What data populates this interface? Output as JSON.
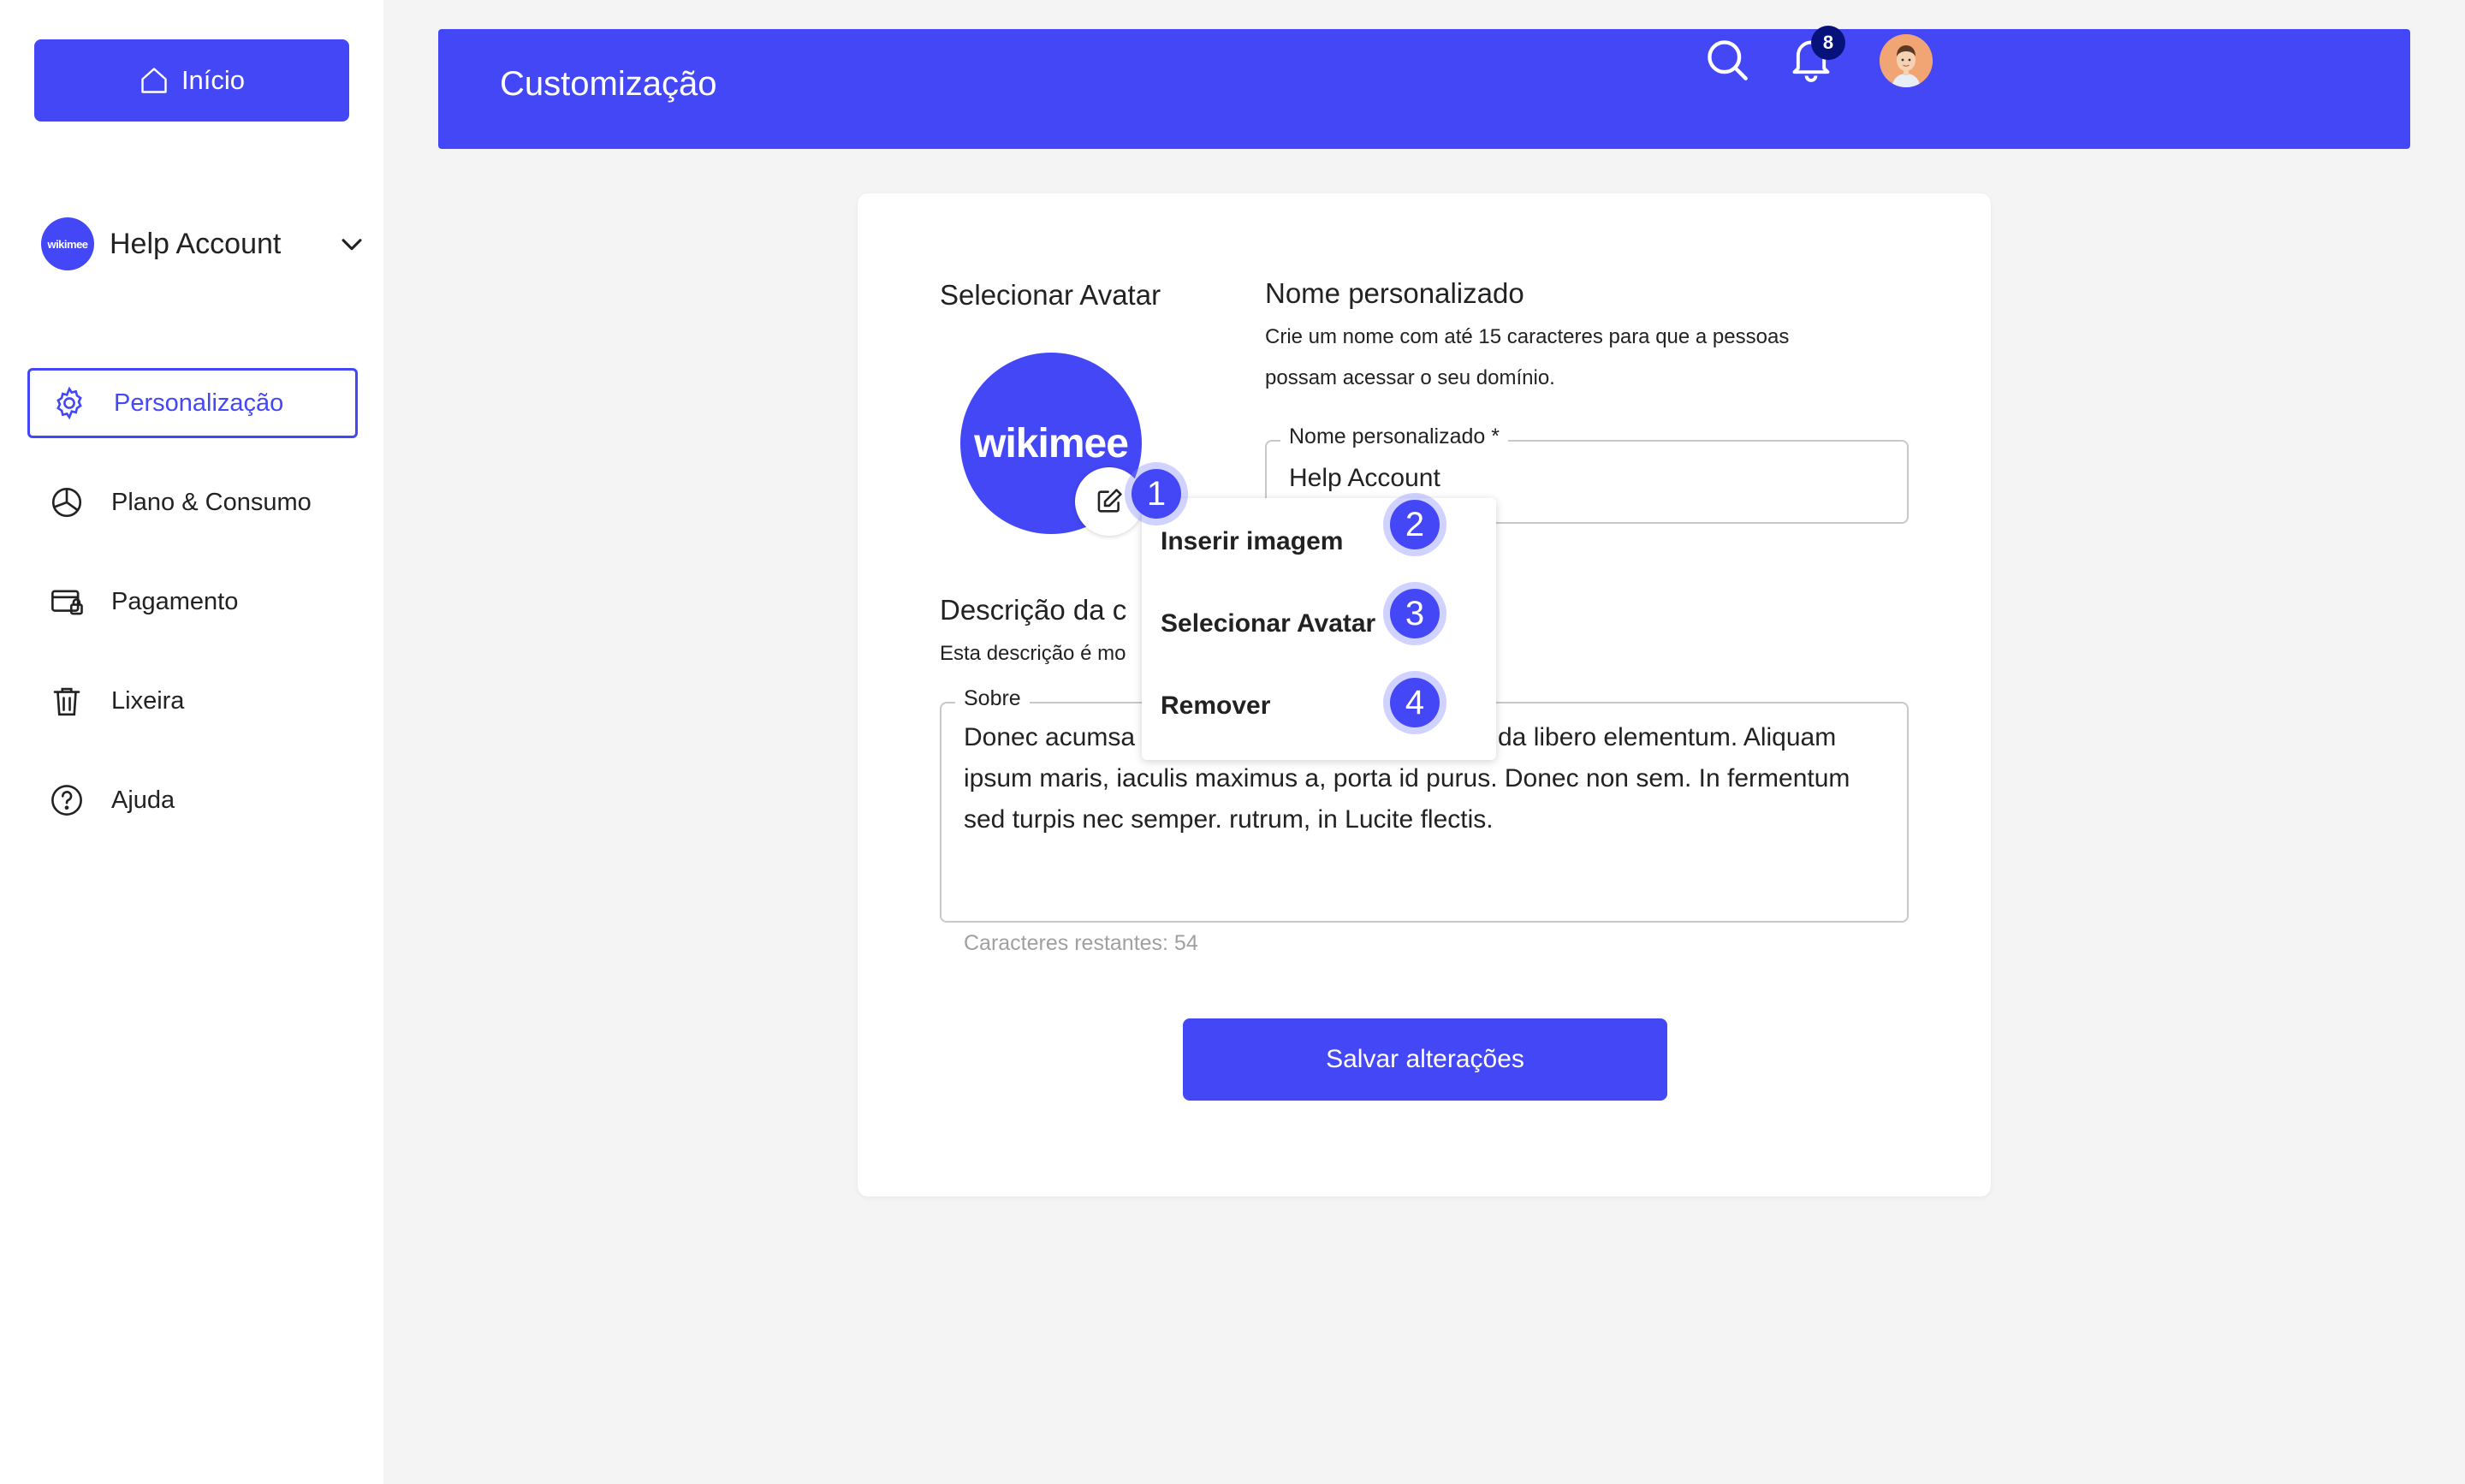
{
  "sidebar": {
    "home_label": "Início",
    "account": {
      "logo_text": "wikimee",
      "name": "Help Account"
    },
    "items": [
      {
        "label": "Personalização",
        "icon": "gear-icon",
        "active": true
      },
      {
        "label": "Plano & Consumo",
        "icon": "pie-chart-icon",
        "active": false
      },
      {
        "label": "Pagamento",
        "icon": "payment-card-icon",
        "active": false
      },
      {
        "label": "Lixeira",
        "icon": "trash-icon",
        "active": false
      },
      {
        "label": "Ajuda",
        "icon": "help-icon",
        "active": false
      }
    ]
  },
  "header": {
    "title": "Customização",
    "notification_count": "8"
  },
  "card": {
    "avatar": {
      "title": "Selecionar Avatar",
      "logo_text": "wikimee"
    },
    "custom_name": {
      "title": "Nome personalizado",
      "help_line1": "Crie um nome com até 15 caracteres para que a pessoas",
      "help_line2": "possam acessar o seu domínio.",
      "field_label": "Nome personalizado *",
      "field_value": "Help Account"
    },
    "description": {
      "title": "Descrição da c",
      "help": "Esta descrição é mo",
      "field_label": "Sobre",
      "value_prefix": "Donec acumsa",
      "value_line1_end": "da libero elementum. Aliquam",
      "value_rest": "ipsum maris, iaculis maximus a, porta id purus. Donec non sem. In fermentum sed turpis nec semper. rutrum, in Lucite flectis.",
      "counter": "Caracteres restantes: 54"
    },
    "save_label": "Salvar alterações"
  },
  "avatar_menu": {
    "items": [
      "Inserir imagem",
      "Selecionar Avatar",
      "Remover"
    ]
  },
  "markers": [
    "1",
    "2",
    "3",
    "4"
  ],
  "colors": {
    "brand": "#4447f5",
    "background": "#f4f4f4",
    "badge": "#06127a"
  }
}
